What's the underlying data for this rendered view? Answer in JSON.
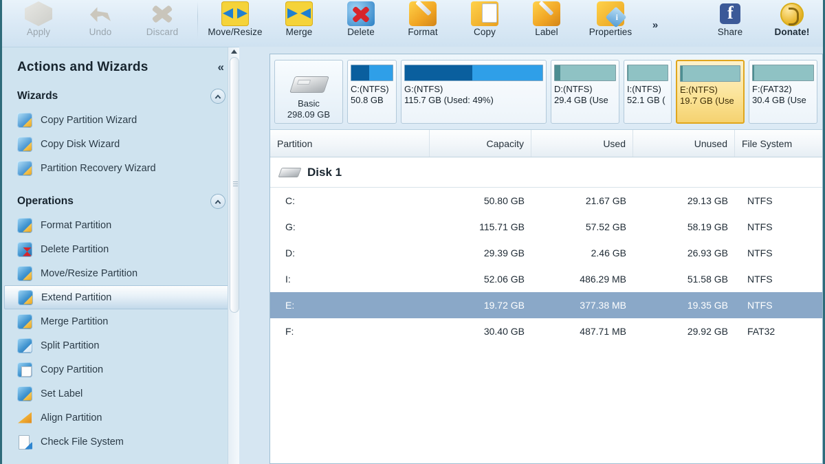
{
  "toolbar": {
    "buttons": [
      {
        "label": "Apply",
        "icon": "apply-icon",
        "disabled": true
      },
      {
        "label": "Undo",
        "icon": "undo-icon",
        "disabled": true
      },
      {
        "label": "Discard",
        "icon": "discard-icon",
        "disabled": true
      },
      {
        "label": "Move/Resize",
        "icon": "move-resize-icon",
        "disabled": false
      },
      {
        "label": "Merge",
        "icon": "merge-icon",
        "disabled": false
      },
      {
        "label": "Delete",
        "icon": "delete-icon",
        "disabled": false
      },
      {
        "label": "Format",
        "icon": "format-icon",
        "disabled": false
      },
      {
        "label": "Copy",
        "icon": "copy-icon",
        "disabled": false
      },
      {
        "label": "Label",
        "icon": "label-icon",
        "disabled": false
      },
      {
        "label": "Properties",
        "icon": "properties-icon",
        "disabled": false
      }
    ],
    "overflow_label": "»",
    "share_label": "Share",
    "donate_label": "Donate!"
  },
  "sidebar": {
    "title": "Actions and Wizards",
    "collapse_label": "«",
    "groups": [
      {
        "title": "Wizards",
        "items": [
          {
            "label": "Copy Partition Wizard"
          },
          {
            "label": "Copy Disk Wizard"
          },
          {
            "label": "Partition Recovery Wizard"
          }
        ]
      },
      {
        "title": "Operations",
        "items": [
          {
            "label": "Format Partition"
          },
          {
            "label": "Delete Partition"
          },
          {
            "label": "Move/Resize Partition"
          },
          {
            "label": "Extend Partition"
          },
          {
            "label": "Merge Partition"
          },
          {
            "label": "Split Partition"
          },
          {
            "label": "Copy Partition"
          },
          {
            "label": "Set Label"
          },
          {
            "label": "Align Partition"
          },
          {
            "label": "Check File System"
          }
        ]
      }
    ],
    "selected_item": "Extend Partition"
  },
  "disk_map": {
    "disk": {
      "type_label": "Basic",
      "size_label": "298.09 GB"
    },
    "blocks": [
      {
        "name": "C:(NTFS)",
        "size_label": "50.8 GB",
        "bar": "blue",
        "used_pct": 43,
        "selected": false
      },
      {
        "name": "G:(NTFS)",
        "size_label": "115.7 GB (Used: 49%)",
        "bar": "blue",
        "used_pct": 49,
        "selected": false
      },
      {
        "name": "D:(NTFS)",
        "size_label": "29.4 GB (Use",
        "bar": "teal",
        "used_pct": 9,
        "selected": false
      },
      {
        "name": "I:(NTFS)",
        "size_label": "52.1 GB (",
        "bar": "teal",
        "used_pct": 2,
        "selected": false
      },
      {
        "name": "E:(NTFS)",
        "size_label": "19.7 GB (Use",
        "bar": "teal",
        "used_pct": 3,
        "selected": true
      },
      {
        "name": "F:(FAT32)",
        "size_label": "30.4 GB (Use",
        "bar": "teal",
        "used_pct": 2,
        "selected": false
      }
    ]
  },
  "table": {
    "headers": [
      "Partition",
      "Capacity",
      "Used",
      "Unused",
      "File System"
    ],
    "disk_group_label": "Disk 1",
    "rows": [
      {
        "partition": "C:",
        "capacity": "50.80 GB",
        "used": "21.67 GB",
        "unused": "29.13 GB",
        "fs": "NTFS",
        "selected": false
      },
      {
        "partition": "G:",
        "capacity": "115.71 GB",
        "used": "57.52 GB",
        "unused": "58.19 GB",
        "fs": "NTFS",
        "selected": false
      },
      {
        "partition": "D:",
        "capacity": "29.39 GB",
        "used": "2.46 GB",
        "unused": "26.93 GB",
        "fs": "NTFS",
        "selected": false
      },
      {
        "partition": "I:",
        "capacity": "52.06 GB",
        "used": "486.29 MB",
        "unused": "51.58 GB",
        "fs": "NTFS",
        "selected": false
      },
      {
        "partition": "E:",
        "capacity": "19.72 GB",
        "used": "377.38 MB",
        "unused": "19.35 GB",
        "fs": "NTFS",
        "selected": true
      },
      {
        "partition": "F:",
        "capacity": "30.40 GB",
        "used": "487.71 MB",
        "unused": "29.92 GB",
        "fs": "FAT32",
        "selected": false
      }
    ]
  }
}
